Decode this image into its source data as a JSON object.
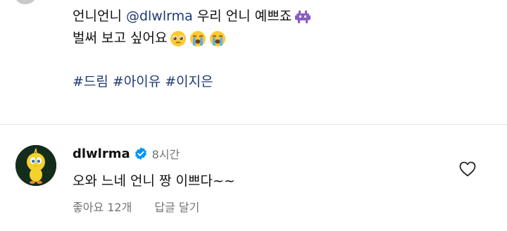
{
  "caption": {
    "line1_text": "언니언니",
    "mention": "@dlwlrma",
    "line1_rest": "우리 언니 예쁘죠",
    "line1_emoji": "purple-invader-emoji",
    "line2_text": "벌써 보고 싶어요",
    "line2_emojis": [
      "pleading-face-emoji",
      "loudly-crying-face-emoji",
      "loudly-crying-face-emoji"
    ],
    "hashtags": [
      "#드림",
      "#아이유",
      "#이지은"
    ]
  },
  "comment": {
    "avatar_icon": "tweety-avatar",
    "username": "dlwlrma",
    "verified_icon": "verified-badge-icon",
    "time": "8시간",
    "text": "오와 느네 언니 짱 이쁘다~~",
    "likes": "좋아요 12개",
    "reply": "답글 달기",
    "like_icon": "heart-icon"
  },
  "colors": {
    "link": "#1e3a73",
    "verified": "#0095f6",
    "meta": "#737373",
    "divider": "#e4e4e4"
  }
}
